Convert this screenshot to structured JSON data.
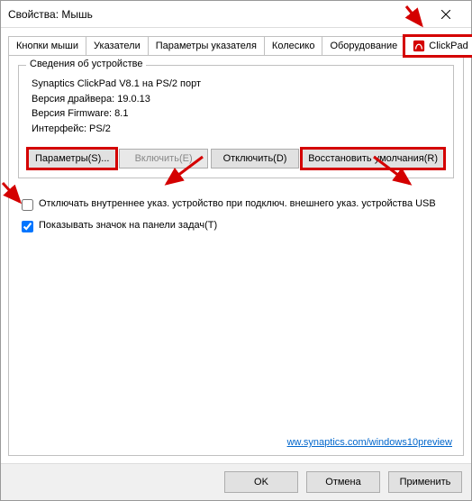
{
  "window": {
    "title": "Свойства: Мышь"
  },
  "tabs": {
    "t0": "Кнопки мыши",
    "t1": "Указатели",
    "t2": "Параметры указателя",
    "t3": "Колесико",
    "t4": "Оборудование",
    "t5": "ClickPad"
  },
  "group": {
    "title": "Сведения об устройстве",
    "line0": "Synaptics ClickPad V8.1 на PS/2 порт",
    "line1": "Версия драйвера: 19.0.13",
    "line2": "Версия Firmware: 8.1",
    "line3": "Интерфейс: PS/2"
  },
  "buttons": {
    "params": "Параметры(S)...",
    "enable": "Включить(E)",
    "disable": "Отключить(D)",
    "restore": "Восстановить умолчания(R)"
  },
  "checks": {
    "disable_internal": "Отключать внутреннее указ. устройство при подключ. внешнего указ. устройства USB",
    "show_tray": "Показывать значок на панели задач(T)"
  },
  "link": {
    "text": "ww.synaptics.com/windows10preview"
  },
  "footer": {
    "ok": "OK",
    "cancel": "Отмена",
    "apply": "Применить"
  }
}
